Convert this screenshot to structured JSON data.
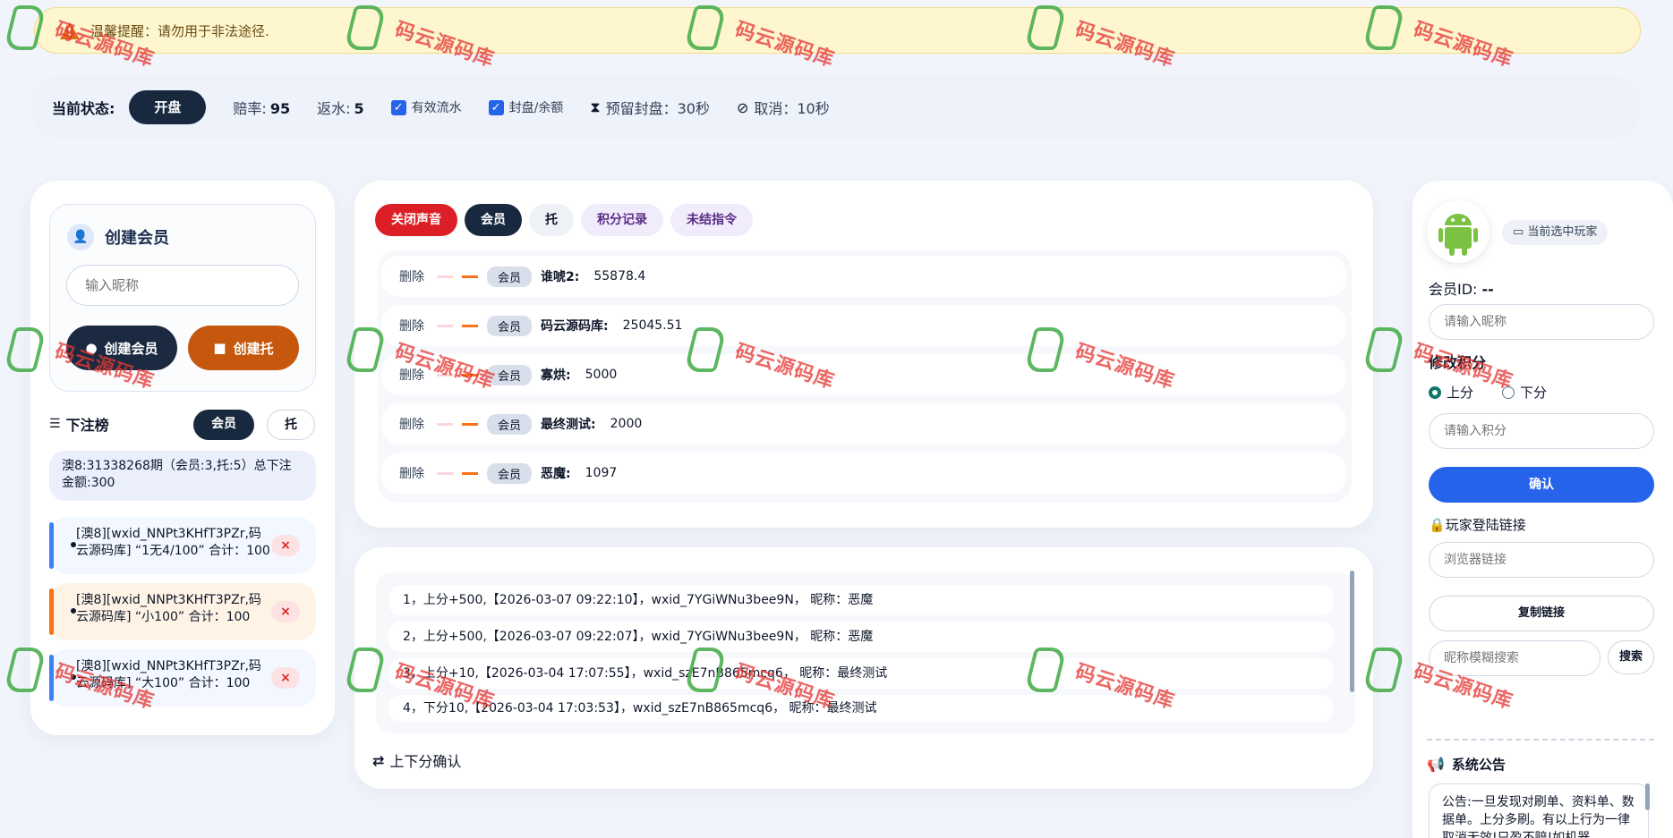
{
  "alert": {
    "text": "温馨提醒：请勿用于非法途径."
  },
  "status": {
    "label": "当前状态:",
    "state": "开盘",
    "odds_label": "赔率:",
    "odds_value": "95",
    "rebate_label": "返水:",
    "rebate_value": "5",
    "check1": "有效流水",
    "check2": "封盘/余额",
    "reserve": "预留封盘：30秒",
    "cancel": "取消：10秒"
  },
  "left": {
    "create_title": "创建会员",
    "nick_placeholder": "输入昵称",
    "create_member_btn": "创建会员",
    "create_bot_btn": "创建托",
    "rank_title": "下注榜",
    "rank_tab_member": "会员",
    "rank_tab_bot": "托",
    "summary": "澳8:31338268期（会员:3,托:5）总下注金额:300",
    "bets": [
      {
        "text": "[澳8][wxid_NNPt3KHfT3PZr,码云源码库] “1无4/100” 合计：100",
        "delete": "×"
      },
      {
        "text": "[澳8][wxid_NNPt3KHfT3PZr,码云源码库] “小100” 合计：100",
        "delete": "×"
      },
      {
        "text": "[澳8][wxid_NNPt3KHfT3PZr,码云源码库] “大100” 合计：100",
        "delete": "×"
      }
    ]
  },
  "middle": {
    "tabs": [
      "关闭声音",
      "会员",
      "托",
      "积分记录",
      "未结指令"
    ],
    "rows": [
      {
        "delete": "删除",
        "tag": "会员",
        "name": "谁唬2:",
        "value": "55878.4"
      },
      {
        "delete": "删除",
        "tag": "会员",
        "name": "码云源码库:",
        "value": "25045.51"
      },
      {
        "delete": "删除",
        "tag": "会员",
        "name": "寡烘:",
        "value": "5000"
      },
      {
        "delete": "删除",
        "tag": "会员",
        "name": "最终测试:",
        "value": "2000"
      },
      {
        "delete": "删除",
        "tag": "会员",
        "name": "恶魔:",
        "value": "1097"
      }
    ],
    "logs": [
      "1，上分+500,【2026-03-07 09:22:10】，wxid_7YGiWNu3bee9N，  昵称：恶魔",
      "2，上分+500,【2026-03-07 09:22:07】，wxid_7YGiWNu3bee9N，  昵称：恶魔",
      "3，上分+10,【2026-03-04 17:07:55】，wxid_szE7nB865mcq6，  昵称：最终测试",
      "4，下分10,【2026-03-04 17:03:53】，wxid_szE7nB865mcq6，  昵称：最终测试"
    ],
    "confirm_label": "上下分确认"
  },
  "right": {
    "selected_badge": "当前选中玩家",
    "member_id_label": "会员ID:",
    "member_id_value": "--",
    "nick_placeholder": "请输入昵称",
    "modify_title": "修改积分",
    "radio_up": "上分",
    "radio_down": "下分",
    "score_placeholder": "请输入积分",
    "confirm_btn": "确认",
    "login_title": "玩家登陆链接",
    "browser_placeholder": "浏览器链接",
    "copy_btn": "复制链接",
    "search_placeholder": "昵称模糊搜索",
    "search_btn": "搜索",
    "notice_title": "系统公告",
    "notice_text": "公告:一旦发现对刷单、资料单、数据单。上分多刷。有以上行为一律取消无效!只盈不赔!如机器"
  },
  "watermark": {
    "text": "码云源码库"
  }
}
